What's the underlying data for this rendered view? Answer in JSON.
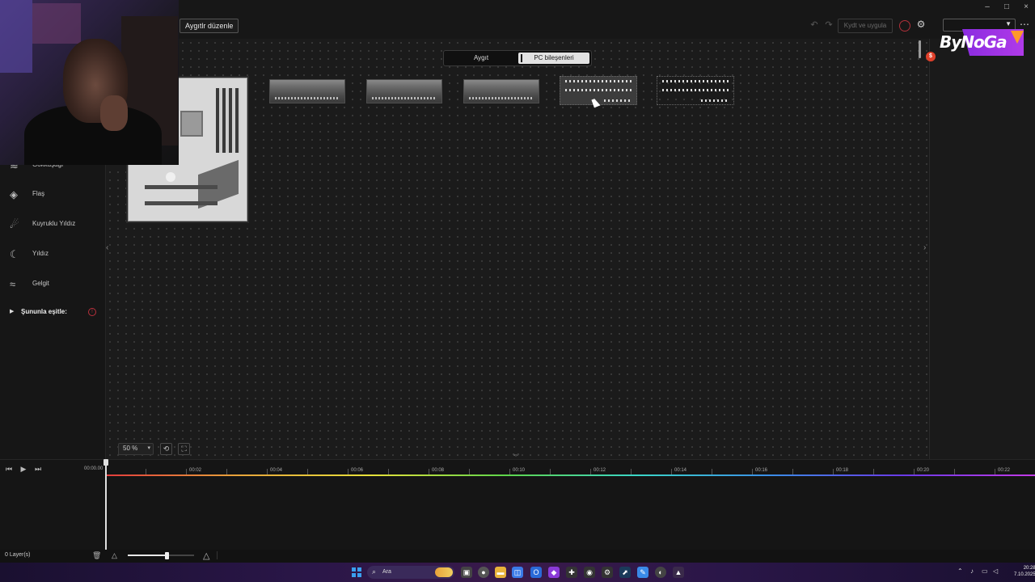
{
  "app": {
    "edit_devices_label": "Aygıtlr düzenle",
    "save_label": "Kydt ve uygula",
    "window_controls": [
      "–",
      "□",
      "×"
    ]
  },
  "toggle": {
    "device_label": "Aygıt",
    "pc_components_label": "PC bileşenleri",
    "selected": "PC bileşenleri"
  },
  "sidebar": {
    "effects": [
      {
        "label": "Gökkuşağı",
        "icon": "rainbow-icon"
      },
      {
        "label": "Flaş",
        "icon": "flash-icon"
      },
      {
        "label": "Kuyruklu Yıldız",
        "icon": "comet-icon"
      },
      {
        "label": "Yıldız",
        "icon": "star-icon"
      },
      {
        "label": "Gelgit",
        "icon": "tide-icon"
      }
    ],
    "section_label": "Şununla eşitle:"
  },
  "canvas": {
    "zoom_value": "50 %",
    "components": [
      "motherboard",
      "ram-1",
      "ram-2",
      "ram-3",
      "led-strip-1",
      "led-strip-2"
    ]
  },
  "timeline": {
    "start_time": "00:00.00",
    "ticks": [
      "00:02",
      "00:04",
      "00:06",
      "00:08",
      "00:10",
      "00:12",
      "00:14",
      "00:16",
      "00:18",
      "00:20",
      "00:22"
    ],
    "layer_count": "0 Layer(s)",
    "zoom_level": 0.6
  },
  "overlay": {
    "logo_text": "ByNoGa",
    "badge": "$"
  },
  "taskbar": {
    "search_label": "Ara",
    "time": "20:28",
    "date": "7.10.2025"
  },
  "colors": {
    "accent_purple": "#8a2ce0",
    "warning_red": "#b8303c",
    "background": "#1a1a1a"
  }
}
